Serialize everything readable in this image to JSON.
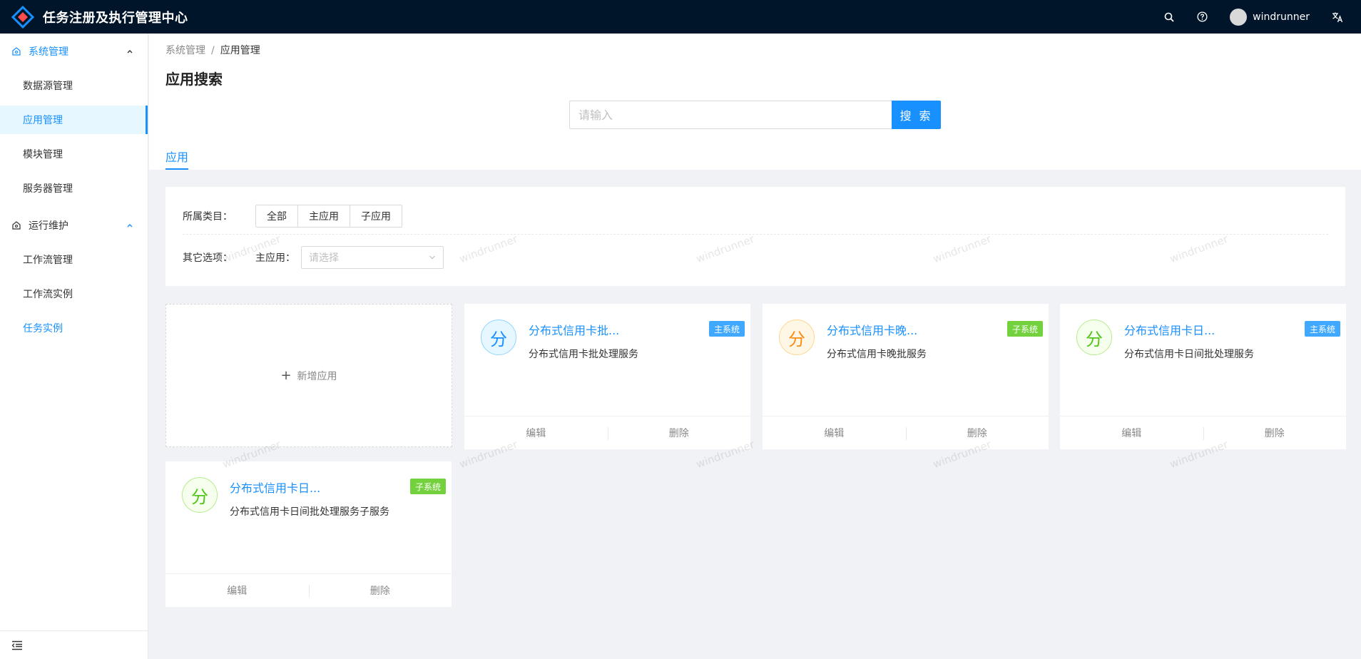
{
  "header": {
    "app_title": "任务注册及执行管理中心",
    "username": "windrunner",
    "icons": [
      "search-icon",
      "help-icon",
      "translate-icon"
    ]
  },
  "sidebar": {
    "groups": [
      {
        "label": "系统管理",
        "items": [
          "数据源管理",
          "应用管理",
          "模块管理",
          "服务器管理"
        ]
      },
      {
        "label": "运行维护",
        "items": [
          "工作流管理",
          "工作流实例",
          "任务实例"
        ]
      }
    ],
    "selected_item": "应用管理"
  },
  "breadcrumb": {
    "parent": "系统管理",
    "separator": "/",
    "current": "应用管理"
  },
  "page": {
    "title": "应用搜索",
    "search_placeholder": "请输入",
    "search_button": "搜 索",
    "tab": "应用"
  },
  "filters": {
    "category_label": "所属类目：",
    "category_options": [
      "全部",
      "主应用",
      "子应用"
    ],
    "other_label": "其它选项：",
    "main_app_label": "主应用：",
    "main_app_placeholder": "请选择"
  },
  "add_card": {
    "label": "新增应用"
  },
  "apps": [
    {
      "avatar": "分",
      "name": "分布式信用卡批...",
      "desc": "分布式信用卡批处理服务",
      "tag": "主系统",
      "edit": "编辑",
      "delete": "删除"
    },
    {
      "avatar": "分",
      "name": "分布式信用卡晚...",
      "desc": "分布式信用卡晚批服务",
      "tag": "子系统",
      "edit": "编辑",
      "delete": "删除"
    },
    {
      "avatar": "分",
      "name": "分布式信用卡日...",
      "desc": "分布式信用卡日间批处理服务",
      "tag": "主系统",
      "edit": "编辑",
      "delete": "删除"
    },
    {
      "avatar": "分",
      "name": "分布式信用卡日...",
      "desc": "分布式信用卡日间批处理服务子服务",
      "tag": "子系统",
      "edit": "编辑",
      "delete": "删除"
    }
  ],
  "watermark": "windrunner",
  "colors": {
    "header_bg": "#001529",
    "primary": "#1890ff",
    "main_tag": "#40a9ff",
    "sub_tag": "#73d13d"
  }
}
